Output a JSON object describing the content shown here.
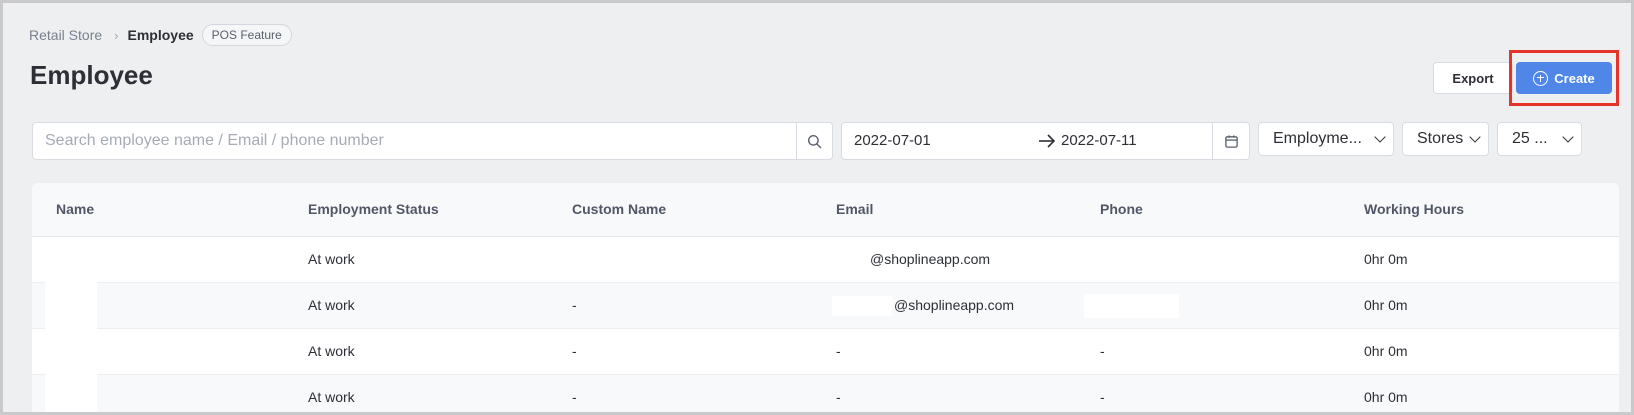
{
  "breadcrumb": {
    "root": "Retail Store",
    "current": "Employee",
    "badge": "POS Feature"
  },
  "page_title": "Employee",
  "toolbar": {
    "export_label": "Export",
    "create_label": "Create"
  },
  "filters": {
    "search_placeholder": "Search employee name / Email / phone number",
    "date_start": "2022-07-01",
    "date_end": "2022-07-11",
    "employment_dropdown": "Employme...",
    "stores_dropdown": "Stores",
    "page_size_dropdown": "25 ..."
  },
  "table": {
    "columns": [
      "Name",
      "Employment Status",
      "Custom Name",
      "Email",
      "Phone",
      "Working Hours"
    ],
    "rows": [
      {
        "name": "",
        "status": "At work",
        "custom_name": "",
        "email": "@shoplineapp.com",
        "phone": "",
        "hours": "0hr 0m"
      },
      {
        "name": "",
        "status": "At work",
        "custom_name": "-",
        "email": "@shoplineapp.com",
        "phone": "",
        "hours": "0hr 0m"
      },
      {
        "name": "",
        "status": "At work",
        "custom_name": "-",
        "email": "-",
        "phone": "-",
        "hours": "0hr 0m"
      },
      {
        "name": "",
        "status": "At work",
        "custom_name": "-",
        "email": "-",
        "phone": "-",
        "hours": "0hr 0m"
      }
    ]
  },
  "colors": {
    "accent": "#4f86e8",
    "highlight": "#e5342a",
    "background": "#eeeff1"
  },
  "icons": [
    "chevron-right-icon",
    "plus-circle-icon",
    "search-icon",
    "arrow-right-icon",
    "calendar-icon",
    "chevron-down-icon"
  ]
}
